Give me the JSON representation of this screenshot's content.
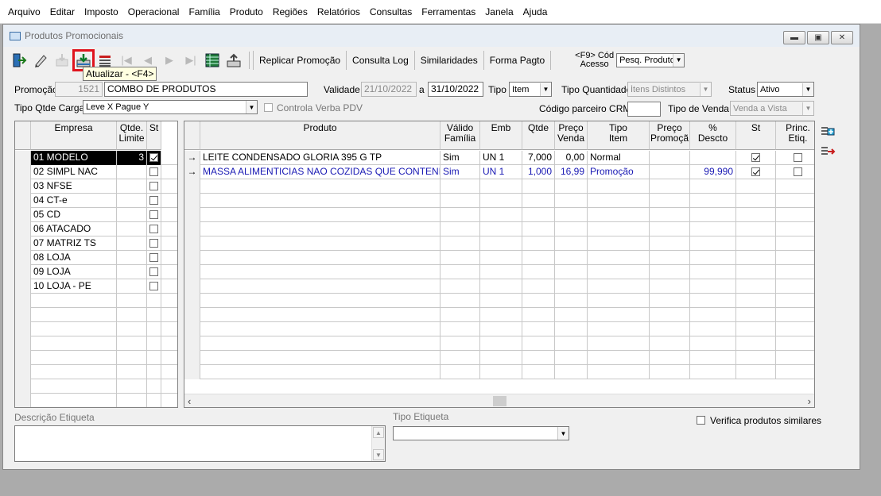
{
  "menu": [
    "Arquivo",
    "Editar",
    "Imposto",
    "Operacional",
    "Família",
    "Produto",
    "Regiões",
    "Relatórios",
    "Consultas",
    "Ferramentas",
    "Janela",
    "Ajuda"
  ],
  "window": {
    "title": "Produtos Promocionais"
  },
  "toolbar": {
    "text_buttons": [
      "Replicar Promoção",
      "Consulta Log",
      "Similaridades",
      "Forma Pagto"
    ],
    "f9_label_1": "<F9> Cód",
    "f9_label_2": "Acesso",
    "search_combo": "Pesq. Produto"
  },
  "tooltip": "Atualizar - <F4>",
  "form": {
    "promocao_label": "Promoção",
    "promocao_code": "1521",
    "promocao_desc": "COMBO DE PRODUTOS",
    "validade_label": "Validade",
    "validade_from": "21/10/2022",
    "validade_sep": "a",
    "validade_to": "31/10/2022",
    "tipo_label": "Tipo",
    "tipo_value": "Item",
    "tipo_qtd_label": "Tipo Quantidade",
    "tipo_qtd_value": "Ítens Distintos",
    "status_label": "Status",
    "status_value": "Ativo",
    "tipo_carga_label": "Tipo Qtde Carga PDV",
    "tipo_carga_value": "Leve X Pague Y",
    "controla_verba_label": "Controla Verba PDV",
    "codigo_crm_label": "Código parceiro CRM",
    "codigo_crm_value": "",
    "tipo_venda_label": "Tipo de Venda",
    "tipo_venda_value": "Venda a Vista"
  },
  "empresa_grid": {
    "headers": {
      "empresa": "Empresa",
      "qtde_1": "Qtde.",
      "qtde_2": "Limite",
      "st": "St"
    },
    "rows": [
      {
        "empresa": "01 MODELO",
        "qtde": "3",
        "st": true,
        "selected": true
      },
      {
        "empresa": "02 SIMPL NAC",
        "qtde": "",
        "st": false
      },
      {
        "empresa": "03 NFSE",
        "qtde": "",
        "st": false
      },
      {
        "empresa": "04 CT-e",
        "qtde": "",
        "st": false
      },
      {
        "empresa": "05 CD",
        "qtde": "",
        "st": false
      },
      {
        "empresa": "06 ATACADO",
        "qtde": "",
        "st": false
      },
      {
        "empresa": "07 MATRIZ TS",
        "qtde": "",
        "st": false
      },
      {
        "empresa": "08 LOJA",
        "qtde": "",
        "st": false
      },
      {
        "empresa": "09 LOJA",
        "qtde": "",
        "st": false
      },
      {
        "empresa": "10 LOJA - PE",
        "qtde": "",
        "st": false
      }
    ]
  },
  "produto_grid": {
    "headers": {
      "produto": "Produto",
      "valido_1": "Válido",
      "valido_2": "Família",
      "emb": "Emb",
      "qtde": "Qtde",
      "preco_venda_1": "Preço",
      "preco_venda_2": "Venda",
      "tipo_item_1": "Tipo",
      "tipo_item_2": "Item",
      "preco_promo_1": "Preço",
      "preco_promo_2": "Promoçã",
      "desc_1": "%",
      "desc_2": "Descto",
      "st": "St",
      "princ_1": "Princ.",
      "princ_2": "Etiq."
    },
    "rows": [
      {
        "indicator": "→",
        "produto": "LEITE CONDENSADO GLORIA 395 G TP",
        "valido": "Sim",
        "emb": "UN  1",
        "qtde": "7,000",
        "preco_venda": "0,00",
        "tipo_item": "Normal",
        "preco_promo": "",
        "desc": "",
        "st": true,
        "princ": false,
        "blue": false
      },
      {
        "indicator": "→",
        "produto": "MASSA ALIMENTICIAS NAO COZIDAS QUE CONTENHAM OVOS",
        "valido": "Sim",
        "emb": "UN  1",
        "qtde": "1,000",
        "preco_venda": "16,99",
        "tipo_item": "Promoção",
        "preco_promo": "",
        "desc": "99,990",
        "st": true,
        "princ": false,
        "blue": true
      }
    ]
  },
  "bottom": {
    "descricao_label": "Descrição Etiqueta",
    "tipo_etiqueta_label": "Tipo Etiqueta",
    "tipo_etiqueta_value": "",
    "verifica_label": "Verifica produtos similares"
  }
}
